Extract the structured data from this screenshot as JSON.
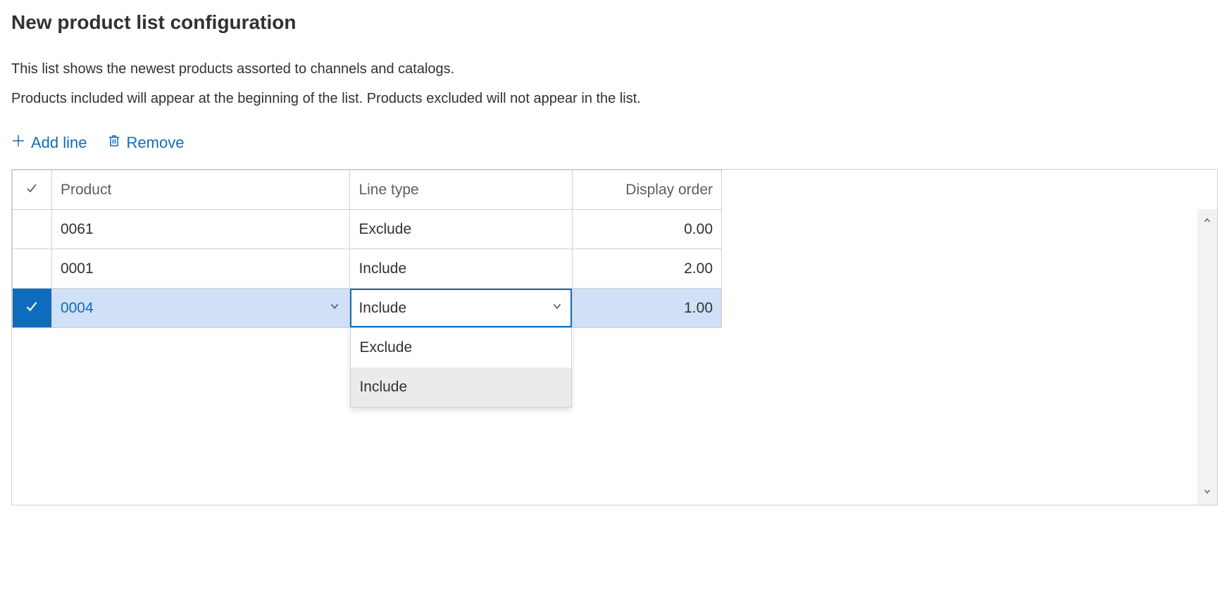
{
  "title": "New product list configuration",
  "description_line1": "This list shows the newest products assorted to channels and catalogs.",
  "description_line2": "Products included will appear at the beginning of the list. Products excluded will not appear in the list.",
  "toolbar": {
    "add_line": "Add line",
    "remove": "Remove"
  },
  "columns": {
    "product": "Product",
    "line_type": "Line type",
    "display_order": "Display order"
  },
  "rows": [
    {
      "product": "0061",
      "line_type": "Exclude",
      "display_order": "0.00",
      "selected": false
    },
    {
      "product": "0001",
      "line_type": "Include",
      "display_order": "2.00",
      "selected": false
    },
    {
      "product": "0004",
      "line_type": "Include",
      "display_order": "1.00",
      "selected": true
    }
  ],
  "dropdown": {
    "options": [
      {
        "label": "Exclude",
        "hover": false
      },
      {
        "label": "Include",
        "hover": true
      }
    ]
  }
}
